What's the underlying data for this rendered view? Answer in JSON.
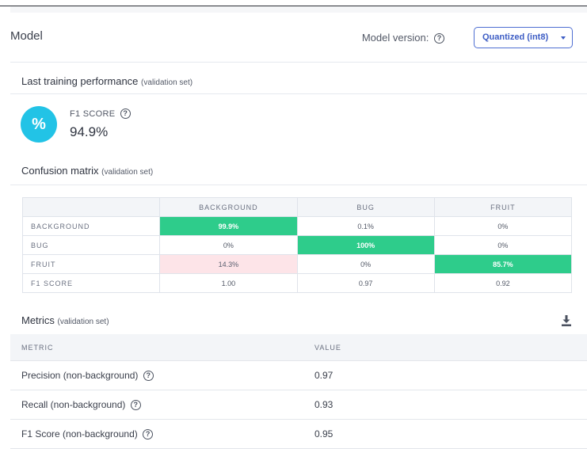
{
  "header": {
    "title": "Model",
    "model_version_label": "Model version:",
    "model_version_value": "Quantized (int8)"
  },
  "training": {
    "title": "Last training performance",
    "subtitle": "(validation set)",
    "f1_label": "F1 SCORE",
    "f1_value": "94.9%",
    "f1_icon": "%"
  },
  "confusion": {
    "title": "Confusion matrix",
    "subtitle": "(validation set)",
    "columns": [
      "BACKGROUND",
      "BUG",
      "FRUIT"
    ],
    "rows": [
      {
        "label": "BACKGROUND",
        "cells": [
          "99.9%",
          "0.1%",
          "0%"
        ]
      },
      {
        "label": "BUG",
        "cells": [
          "0%",
          "100%",
          "0%"
        ]
      },
      {
        "label": "FRUIT",
        "cells": [
          "14.3%",
          "0%",
          "85.7%"
        ]
      }
    ],
    "f1_row": {
      "label": "F1 SCORE",
      "cells": [
        "1.00",
        "0.97",
        "0.92"
      ]
    },
    "colors": {
      "correct": "#2ecc8b",
      "misclass": "#fde4e8"
    }
  },
  "metrics": {
    "title": "Metrics",
    "subtitle": "(validation set)",
    "col_metric": "METRIC",
    "col_value": "VALUE",
    "rows": [
      {
        "label": "Precision (non-background)",
        "value": "0.97"
      },
      {
        "label": "Recall (non-background)",
        "value": "0.93"
      },
      {
        "label": "F1 Score (non-background)",
        "value": "0.95"
      }
    ]
  },
  "icons": {
    "help": "help-circle-icon",
    "download": "download-icon",
    "caret": "caret-down-icon"
  },
  "colors": {
    "accent": "#3c5cc4",
    "f1_circle": "#22c3e6"
  }
}
